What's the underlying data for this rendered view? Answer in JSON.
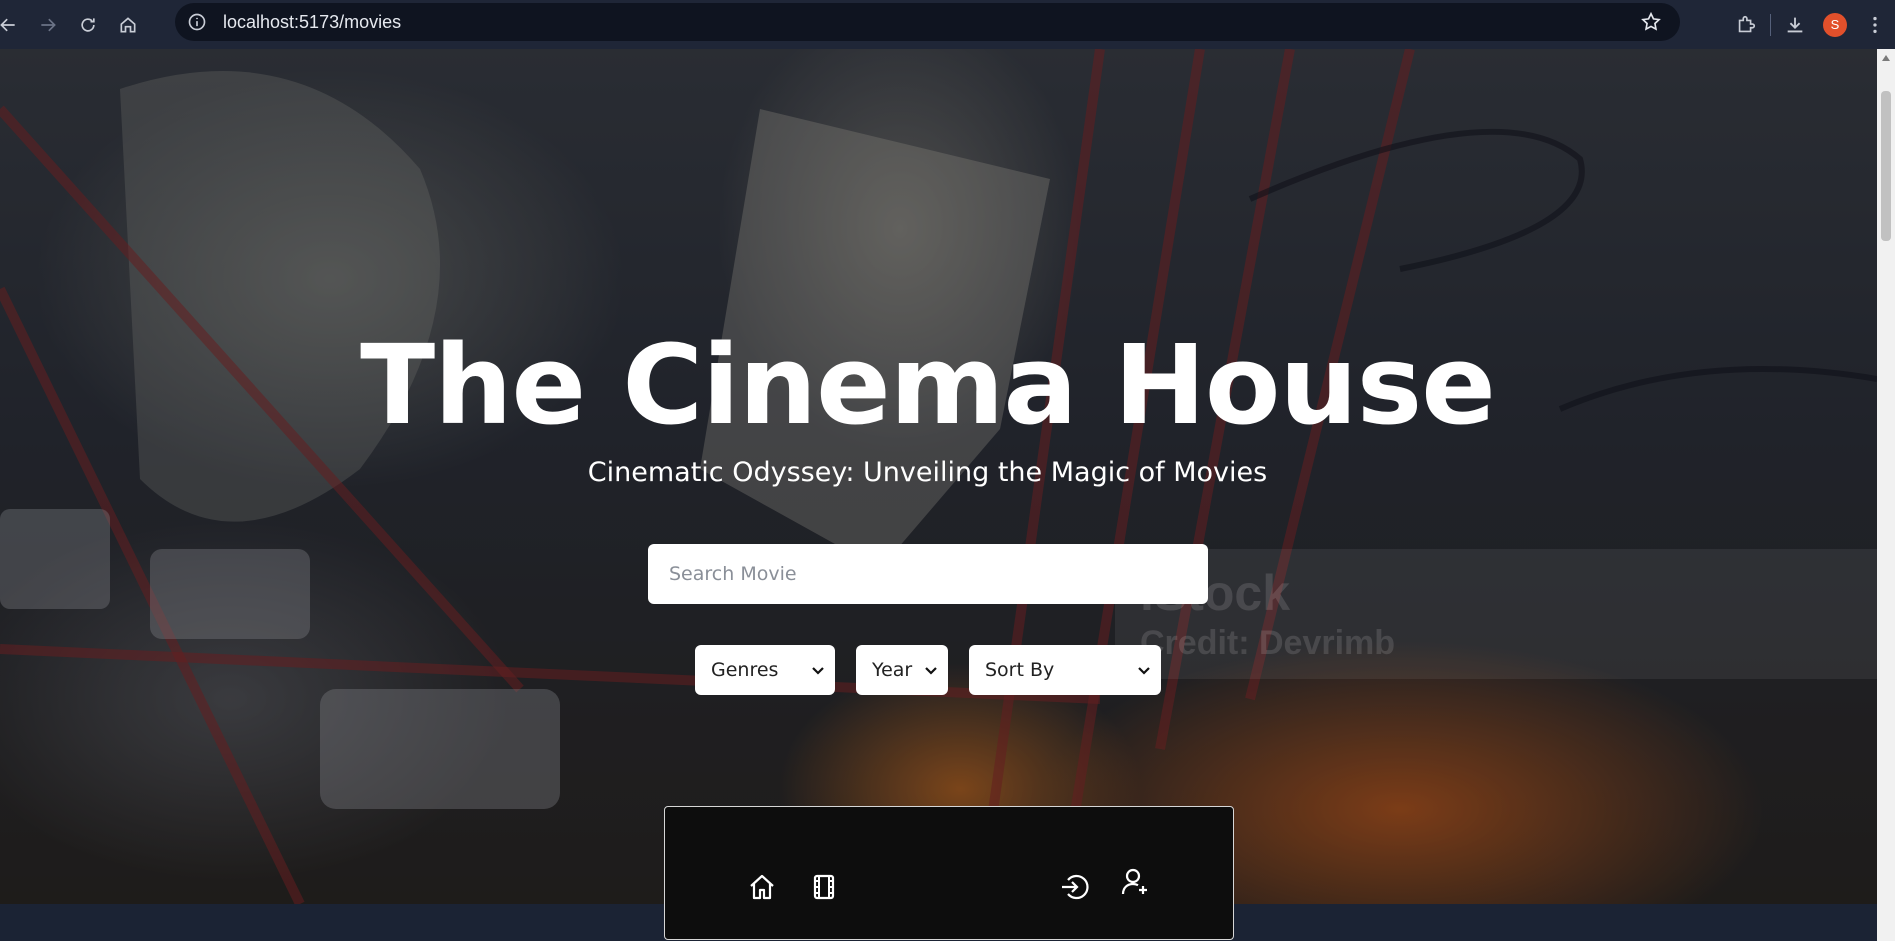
{
  "browser": {
    "url": "localhost:5173/movies",
    "profile_initial": "S",
    "profile_color": "#e2502b"
  },
  "hero": {
    "title": "The Cinema House",
    "subtitle": "Cinematic Odyssey: Unveiling the Magic of Movies",
    "search_placeholder": "Search Movie",
    "watermark_logo": "iStock",
    "watermark_credit": "Credit: Devrimb"
  },
  "filters": {
    "genres_label": "Genres",
    "year_label": "Year",
    "sort_label": "Sort By"
  },
  "dock": {
    "icons": [
      "home-icon",
      "film-icon",
      "login-icon",
      "user-add-icon"
    ]
  },
  "colors": {
    "chrome": "#1f2637",
    "omnibox": "#0f1420",
    "dock": "#0d0d0d",
    "page_bg": "#1b2334"
  }
}
